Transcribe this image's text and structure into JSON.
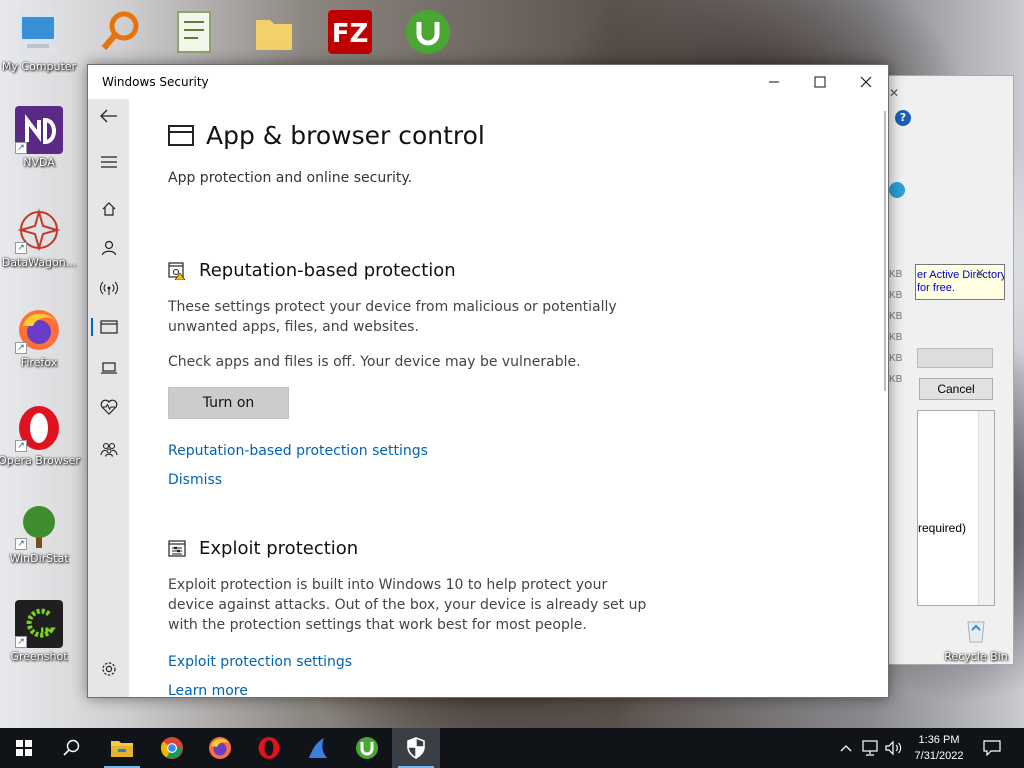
{
  "desktop": {
    "icons": [
      {
        "label": "My Computer"
      },
      {
        "label": "NVDA"
      },
      {
        "label": "DataWagon..."
      },
      {
        "label": "Firefox"
      },
      {
        "label": "Opera Browser"
      },
      {
        "label": "WinDirStat"
      },
      {
        "label": "Greenshot"
      }
    ],
    "recycle_bin": "Recycle Bin"
  },
  "background_dialog": {
    "popup_line1": "er Active Directory.",
    "popup_line2": "for free.",
    "cancel_label": "Cancel",
    "list_text": "required)",
    "sizes": [
      "KB",
      "KB",
      "KB",
      "KB",
      "KB",
      "KB"
    ]
  },
  "window": {
    "title": "Windows Security",
    "controls": {
      "minimize": "—",
      "maximize": "☐",
      "close": "✕"
    }
  },
  "page": {
    "title": "App & browser control",
    "subtitle": "App protection and online security.",
    "reputation": {
      "title": "Reputation-based protection",
      "description": "These settings protect your device from malicious or potentially unwanted apps, files, and websites.",
      "warning": "Check apps and files is off. Your device may be vulnerable.",
      "turn_on_label": "Turn on",
      "settings_link": "Reputation-based protection settings",
      "dismiss_link": "Dismiss"
    },
    "exploit": {
      "title": "Exploit protection",
      "description": "Exploit protection is built into Windows 10 to help protect your device against attacks.  Out of the box, your device is already set up with the protection settings that work best for most people.",
      "settings_link": "Exploit protection settings",
      "learn_more_link": "Learn more"
    }
  },
  "taskbar": {
    "time": "1:36 PM",
    "date": "7/31/2022"
  },
  "colors": {
    "accent": "#0067c0",
    "link": "#0063b1",
    "nav_bg": "#e6e6e6",
    "taskbar_bg": "#101418"
  }
}
